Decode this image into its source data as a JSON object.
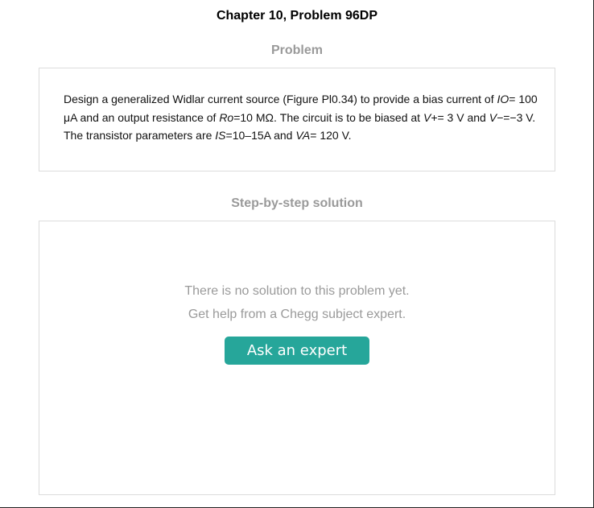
{
  "page": {
    "title": "Chapter 10, Problem 96DP"
  },
  "problem": {
    "heading": "Problem",
    "text_parts": [
      "Design a generalized Widlar current source (Figure Pl0.34) to provide a bias current of ",
      "IO",
      "= 100 μA and an output resistance of ",
      "Ro",
      "=10 MΩ. The circuit is to be biased at ",
      "V+",
      "= 3 V and ",
      "V−",
      "=−3 V. The transistor parameters are ",
      "IS",
      "=10–15A and ",
      "VA",
      "= 120 V."
    ]
  },
  "solution": {
    "heading": "Step-by-step solution",
    "empty_line1": "There is no solution to this problem yet.",
    "empty_line2": "Get help from a Chegg subject expert.",
    "button_label": "Ask an expert"
  },
  "colors": {
    "accent": "#26a69a",
    "muted_text": "#9a9a9a",
    "border": "#dcdcdc"
  }
}
